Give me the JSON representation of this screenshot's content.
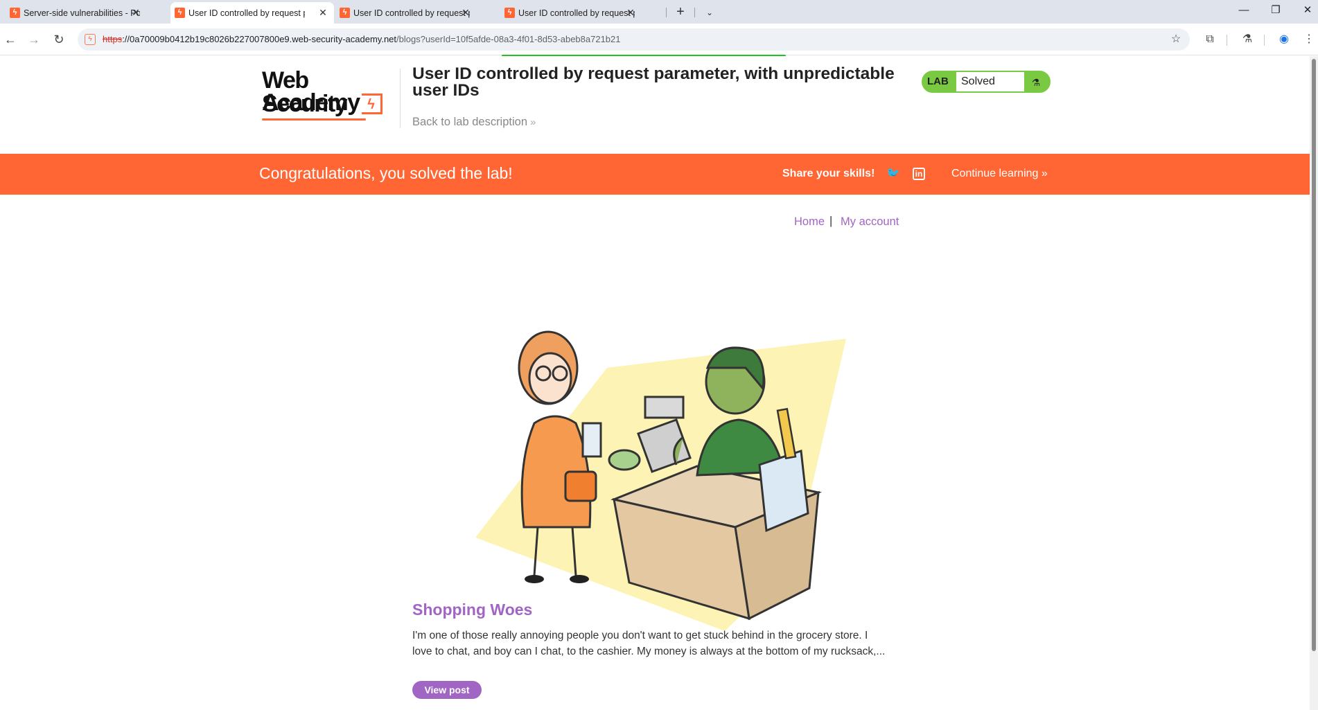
{
  "browser": {
    "tabs": [
      {
        "label": "Server-side vulnerabilities - Por",
        "active": false
      },
      {
        "label": "User ID controlled by request p",
        "active": true
      },
      {
        "label": "User ID controlled by request p",
        "active": false
      },
      {
        "label": "User ID controlled by request p",
        "active": false
      }
    ],
    "new_tab_glyph": "+",
    "url": {
      "scheme": "https",
      "host": "://0a70009b0412b19c8026b227007800e9.web-security-academy.net",
      "path": "/blogs?userId=10f5afde-08a3-4f01-8d53-abeb8a721b21"
    }
  },
  "header": {
    "logo_line1": "Web Security",
    "logo_line2": "Academy",
    "lab_title": "User ID controlled by request parameter, with unpredictable user IDs",
    "back_link": "Back to lab description",
    "badge_label": "LAB",
    "badge_status": "Solved"
  },
  "banner": {
    "message": "Congratulations, you solved the lab!",
    "share": "Share your skills!",
    "continue": "Continue learning"
  },
  "nav": {
    "home": "Home",
    "separator": "|",
    "account": "My account"
  },
  "post": {
    "title": "Shopping Woes",
    "summary": "I'm one of those really annoying people you don't want to get stuck behind in the grocery store. I love to chat, and boy can I chat, to the cashier. My money is always at the bottom of my rucksack,...",
    "button": "View post"
  },
  "colors": {
    "accent": "#ff6633",
    "link": "#a165c4",
    "badge": "#7ac943"
  }
}
